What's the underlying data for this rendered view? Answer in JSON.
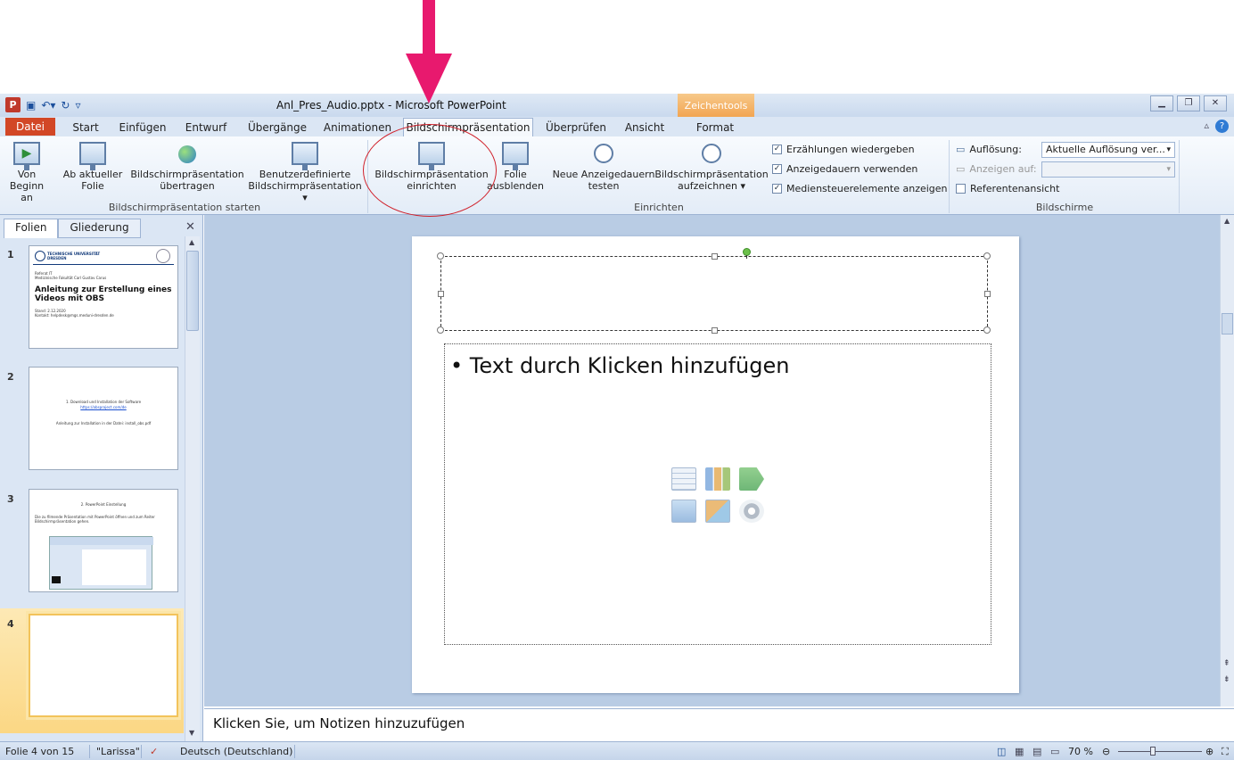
{
  "window": {
    "title": "Anl_Pres_Audio.pptx - Microsoft PowerPoint",
    "context_tab_group": "Zeichentools",
    "app_icon_letter": "P"
  },
  "tabs": [
    "Datei",
    "Start",
    "Einfügen",
    "Entwurf",
    "Übergänge",
    "Animationen",
    "Bildschirmpräsentation",
    "Überprüfen",
    "Ansicht",
    "Format"
  ],
  "ribbon": {
    "group1_label": "Bildschirmpräsentation starten",
    "btn_von_beginn": [
      "Von",
      "Beginn an"
    ],
    "btn_ab_aktueller": [
      "Ab aktueller",
      "Folie"
    ],
    "btn_uebertragen": [
      "Bildschirmpräsentation",
      "übertragen"
    ],
    "btn_benutzer": [
      "Benutzerdefinierte",
      "Bildschirmpräsentation ▾"
    ],
    "group2_label": "Einrichten",
    "btn_einrichten": [
      "Bildschirmpräsentation",
      "einrichten"
    ],
    "btn_ausblenden": [
      "Folie",
      "ausblenden"
    ],
    "btn_neue_anzeige": [
      "Neue Anzeigedauern",
      "testen"
    ],
    "btn_aufzeichnen": [
      "Bildschirmpräsentation",
      "aufzeichnen ▾"
    ],
    "chk_erzaehlungen": "Erzählungen wiedergeben",
    "chk_anzeigedauern": "Anzeigedauern verwenden",
    "chk_medien": "Mediensteuerelemente anzeigen",
    "group3_label": "Bildschirme",
    "aufloesung_label": "Auflösung:",
    "aufloesung_value": "Aktuelle Auflösung ver...",
    "anzeigen_auf_label": "Anzeigen auf:",
    "referentenansicht": "Referentenansicht"
  },
  "left_pane": {
    "tab_folien": "Folien",
    "tab_gliederung": "Gliederung",
    "slides": [
      {
        "num": "1",
        "logo_text": "TECHNISCHE UNIVERSITÄT DRESDEN",
        "line1": "Referat IT",
        "line2": "Medizinische Fakultät Carl Gustav Carus",
        "title": "Anleitung zur Erstellung eines Videos mit OBS",
        "meta1": "Stand: 2.12.2020",
        "meta2": "Kontakt: helpdesk@mgs.meduni-dresden.de"
      },
      {
        "num": "2",
        "line1": "1. Download und Installation der Software",
        "link": "https://obsproject.com/de",
        "line2": "Anleitung zur Installation in der Datei: install_obs.pdf"
      },
      {
        "num": "3",
        "title": "2. PowerPoint Einstellung",
        "line1": "Die zu filmende Präsentation mit PowerPoint öffnen und zum Reiter Bildschirmpräsentation gehen."
      },
      {
        "num": "4"
      }
    ]
  },
  "slide": {
    "body_text": "Text durch Klicken hinzufügen"
  },
  "notes_placeholder": "Klicken Sie, um Notizen hinzuzufügen",
  "status": {
    "slide_info": "Folie 4 von 15",
    "theme": "\"Larissa\"",
    "language": "Deutsch (Deutschland)",
    "zoom": "70 %"
  },
  "colors": {
    "annotation_arrow": "#e8196e",
    "annotation_circle": "#d0202a",
    "file_tab": "#d24726",
    "context_tab": "#f2a552"
  }
}
